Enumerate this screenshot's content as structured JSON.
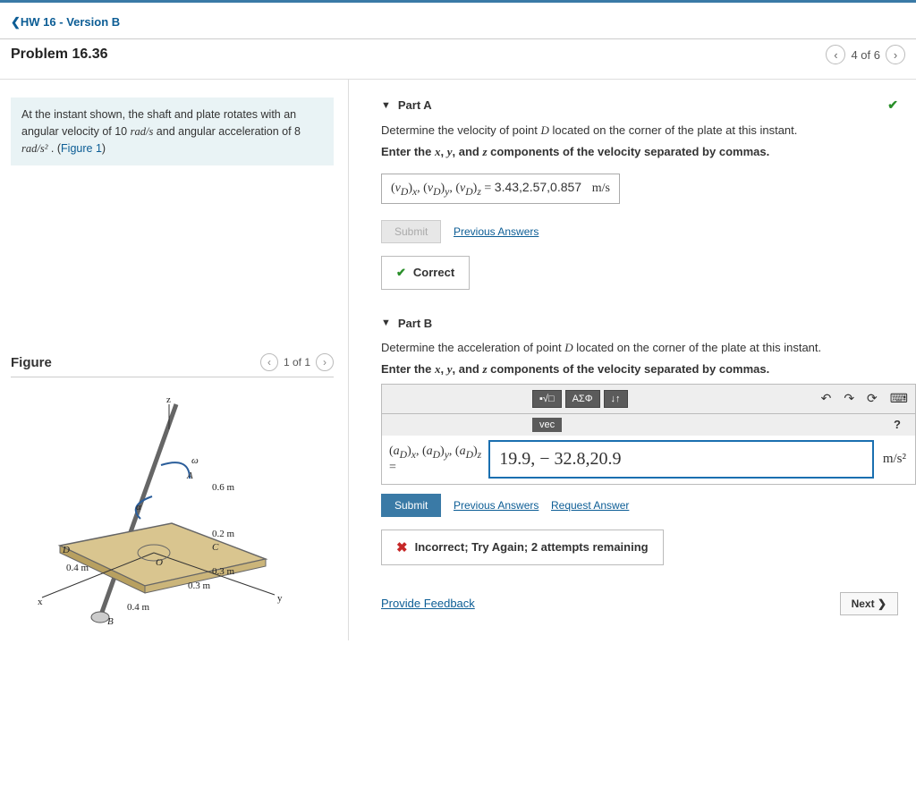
{
  "breadcrumb": {
    "back_chevron": "❮",
    "label": "HW 16 - Version B"
  },
  "problem": {
    "title": "Problem 16.36"
  },
  "pager": {
    "text": "4 of 6",
    "prev": "‹",
    "next": "›"
  },
  "prompt": {
    "text1": "At the instant shown, the shaft and plate rotates with an angular velocity of 10 ",
    "unit1": "rad/s",
    "text2": " and angular acceleration of 8 ",
    "unit2": "rad/s²",
    "text3": " . (",
    "figref": "Figure 1",
    "text4": ")"
  },
  "figure": {
    "heading": "Figure",
    "pager": "1 of 1",
    "labels": {
      "z": "z",
      "x": "x",
      "y": "y",
      "omega": "ω",
      "alpha": "α",
      "A": "A",
      "B": "B",
      "C": "C",
      "D": "D",
      "O": "O"
    },
    "dims": {
      "d06": "0.6 m",
      "d02": "0.2 m",
      "d03a": "0.3 m",
      "d03b": "0.3 m",
      "d04a": "0.4 m",
      "d04b": "0.4 m"
    }
  },
  "partA": {
    "label": "Part A",
    "desc": "Determine the velocity of point ",
    "desc_var": "D",
    "desc2": " located on the corner of the plate at this instant.",
    "instruction_pre": "Enter the ",
    "ix": "x",
    "iy": "y",
    "iz": "z",
    "instruction_mid": ", and ",
    "instruction_post": " components of the velocity separated by commas.",
    "lhs": "(v_D)_x, (v_D)_y, (v_D)_z =",
    "value": "3.43,2.57,0.857",
    "unit": "m/s",
    "submit": "Submit",
    "prev": "Previous Answers",
    "feedback": "Correct"
  },
  "partB": {
    "label": "Part B",
    "desc": "Determine the acceleration of point ",
    "desc_var": "D",
    "desc2": " located on the corner of the plate at this instant.",
    "instruction_pre": "Enter the ",
    "ix": "x",
    "iy": "y",
    "iz": "z",
    "instruction_mid": ", and ",
    "instruction_post": " components of the velocity separated by commas.",
    "toolbar": {
      "b1": "√□",
      "b2": "ΑΣΦ",
      "b3": "↓↑",
      "undo": "↶",
      "redo": "↷",
      "reset": "⟳",
      "kbd": "⌨",
      "vec": "vec",
      "help": "?"
    },
    "lhs": "(a_D)_x, (a_D)_y, (a_D)_z =",
    "value": "19.9, − 32.8,20.9",
    "unit": "m/s²",
    "submit": "Submit",
    "prev": "Previous Answers",
    "req": "Request Answer",
    "feedback": "Incorrect; Try Again; 2 attempts remaining"
  },
  "footer": {
    "feedback": "Provide Feedback",
    "next": "Next ❯"
  }
}
